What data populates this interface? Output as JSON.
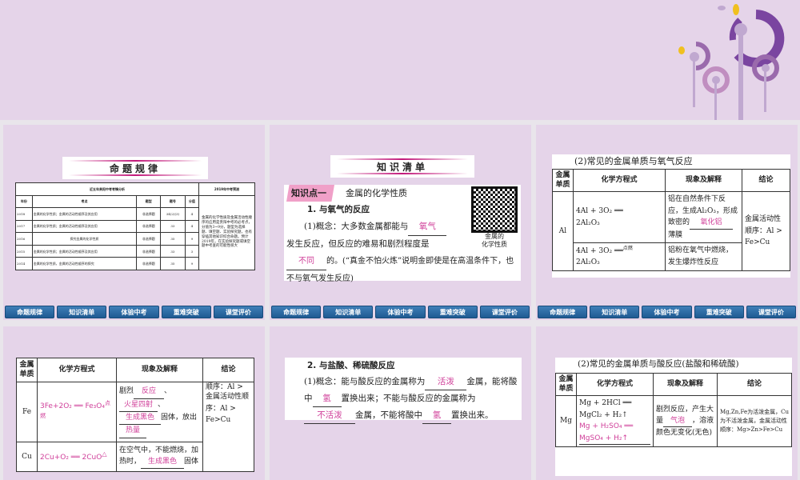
{
  "nav": [
    "命题规律",
    "知识清单",
    "体验中考",
    "重难突破",
    "课堂评价"
  ],
  "slide1": {
    "banner": "命题规律",
    "table_title": "近五年贵阳中考考情分析",
    "predict_title": "2019年中考预测",
    "headers": [
      "年份",
      "考点",
      "题型",
      "题号",
      "分值"
    ],
    "rows": [
      [
        "2018",
        "金属的化学性质；金属的活动性顺序及其应用",
        "非选择题",
        "34(2)(3)",
        "4"
      ],
      [
        "2017",
        "金属的化学性质；金属的活动性顺序及其应用",
        "非选择题",
        "33",
        "4"
      ],
      [
        "2016",
        "探究金属的化学性质",
        "非选择题",
        "35",
        "9"
      ],
      [
        "2015",
        "金属的化学性质；金属的活动性顺序及其应用",
        "非选择题",
        "33",
        "3"
      ],
      [
        "2014",
        "金属的化学性质，金属的活动性顺序的探究",
        "非选择题",
        "35",
        "9"
      ]
    ],
    "prediction": "金属的化学性质及金属活动性顺序的应用是贵阳中考的必考点，分值为3~9分，题型为选择题、填空题、实验探究题，也有穿插其他知识综合命题。预计2019年，在实验探究题或填空题中考查的可能性很大"
  },
  "slide2": {
    "banner": "知识清单",
    "tag": "知识点一",
    "topic": "金属的化学性质",
    "heading": "1. 与氧气的反应",
    "qr_caption1": "金属的",
    "qr_caption2": "化学性质",
    "p1": "(1)概念：大多数金属都能与",
    "a1": "氧气",
    "p2": "发生反应，但反应的难易和剧烈程度是",
    "a2": "不同",
    "p3": "的。(“真金不怕火炼”说明金即使是在高温条件下，也不与氧气发生反应)"
  },
  "slide3": {
    "title": "(2)常见的金属单质与氧气反应",
    "headers": [
      "金属单质",
      "化学方程式",
      "现象及解释",
      "结论"
    ],
    "metal": "Al",
    "eq1a": "4Al + 3O₂ ══",
    "eq1b": "2Al₂O₃",
    "ph1a": "铝在自然条件下反应，生成Al₂O₃，形成致密的",
    "ph1ans": "氧化铝",
    "ph1b": "薄膜",
    "eq2a": "4Al + 3O₂ ══",
    "eq2cond": "点燃",
    "eq2b": "2Al₂O₃",
    "ph2": "铝粉在氧气中燃烧，发生爆炸性反应",
    "conclusion": "金属活动性顺序：Al > Fe>Cu"
  },
  "slide4": {
    "headers": [
      "金属单质",
      "化学方程式",
      "现象及解释",
      "结论"
    ],
    "fe": "Fe",
    "fe_eq": "3Fe+2O₂ ══ Fe₃O₄",
    "fe_cond": "点燃",
    "fe_p1": "剧烈",
    "fe_a1": "反应",
    "fe_a2": "火星四射",
    "fe_a3": "生成黑色",
    "fe_p2": "固体，放出",
    "fe_a4": "热量",
    "cu": "Cu",
    "cu_eq": "2Cu+O₂ ══ 2CuO",
    "cu_cond": "△",
    "cu_p1": "在空气中，不能燃烧，加热时，",
    "cu_a1": "生成黑色",
    "cu_p2": "固体",
    "conclusion_top": "顺序：Al >",
    "conclusion": "金属活动性顺序：Al > Fe>Cu"
  },
  "slide5": {
    "heading": "2. 与盐酸、稀硫酸反应",
    "p1": "(1)概念：能与酸反应的金属称为",
    "a1": "活泼",
    "p2": "金属，能将酸中",
    "a2": "氢",
    "p3": "置换出来；不能与酸反应的金属称为",
    "a3": "不活泼",
    "p4": "金属，不能将酸中",
    "a4": "氢",
    "p5": "置换出来。"
  },
  "slide6": {
    "title": "(2)常见的金属单质与酸反应(盐酸和稀硫酸)",
    "headers": [
      "金属单质",
      "化学方程式",
      "现象及解释",
      "结论"
    ],
    "metal": "Mg",
    "eq1": "Mg + 2HCl ══ MgCl₂ + H₂↑",
    "eq2": "Mg + H₂SO₄ ══ MgSO₄ + H₂↑",
    "ph1": "剧烈反应，产生大量",
    "ph_ans": "气泡",
    "ph2": "，溶液颜色无变化(无色)",
    "conclusion": "Mg,Zn,Fe为活泼金属，Cu为不活泼金属，金属活动性顺序：Mg>Zn>Fe>Cu"
  }
}
